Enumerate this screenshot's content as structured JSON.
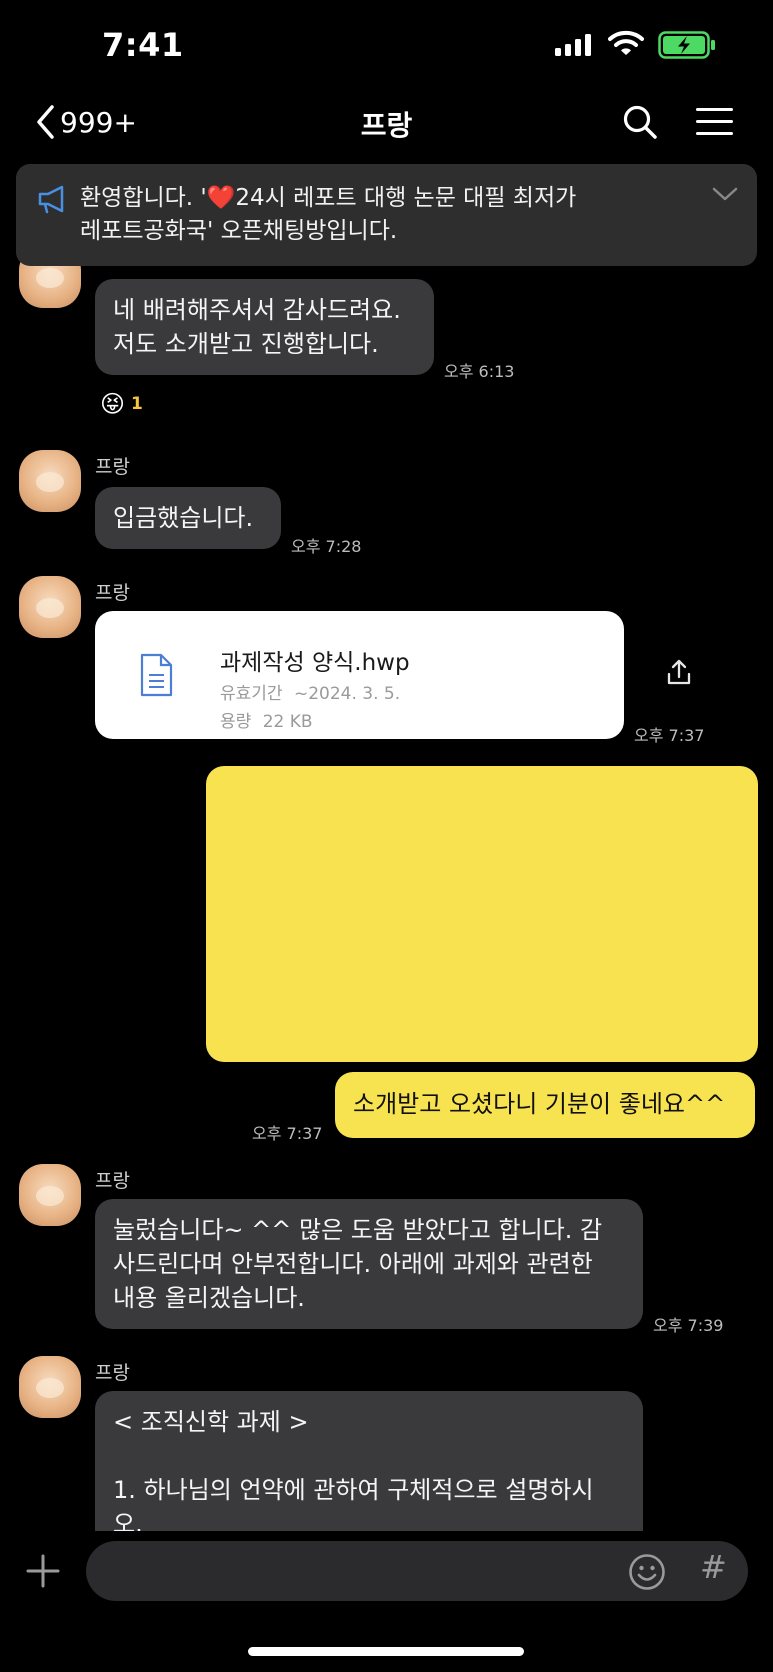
{
  "status_bar": {
    "time": "7:41"
  },
  "header": {
    "back_count": "999+",
    "title": "프랑"
  },
  "notice": {
    "text": "환영합니다. '❤️24시 레포트 대행 논문 대필 최저가 레포트공화국' 오픈채팅방입니다."
  },
  "messages": [
    {
      "lines": [
        "네 배려해주셔서 감사드려요.",
        "저도 소개받고 진행합니다."
      ],
      "time": "오후 6:13",
      "reaction": {
        "emoji": "😝",
        "count": "1"
      }
    },
    {
      "sender": "프랑",
      "lines": [
        "입금했습니다."
      ],
      "time": "오후 7:28"
    },
    {
      "sender": "프랑",
      "file": {
        "name": "과제작성 양식.hwp",
        "expiry_label": "유효기간",
        "expiry_value": "~2024. 3. 5.",
        "size_label": "용량",
        "size_value": "22 KB"
      },
      "time": "오후 7:37"
    },
    {
      "mine": true,
      "lines": [
        "소개받고 오셨다니 기분이 좋네요^^"
      ],
      "time": "오후 7:37"
    },
    {
      "sender": "프랑",
      "lines": [
        "눌렀습니다~ ^^ 많은 도움 받았다고 합니다. 감",
        "사드린다며 안부전합니다. 아래에 과제와 관련한",
        "내용 올리겠습니다."
      ],
      "time": "오후 7:39"
    },
    {
      "sender": "프랑",
      "lines": [
        "< 조직신학 과제 >",
        "",
        "1. 하나님의 언약에 관하여 구체적으로 설명하시",
        "오."
      ]
    }
  ],
  "input": {
    "placeholder": ""
  },
  "icons": {
    "back": "chevron-left-icon",
    "search": "search-icon",
    "menu": "hamburger-menu-icon",
    "notice": "megaphone-icon",
    "notice_toggle": "chevron-down-icon",
    "file": "document-icon",
    "share": "share-icon",
    "plus": "plus-icon",
    "emoji": "emoji-icon",
    "hash": "#"
  },
  "colors": {
    "background": "#000000",
    "bubble_other": "#3a3a3c",
    "bubble_mine": "#f7e34f",
    "notice_bg": "#2e2e2e",
    "battery_fill": "#4cd964"
  }
}
